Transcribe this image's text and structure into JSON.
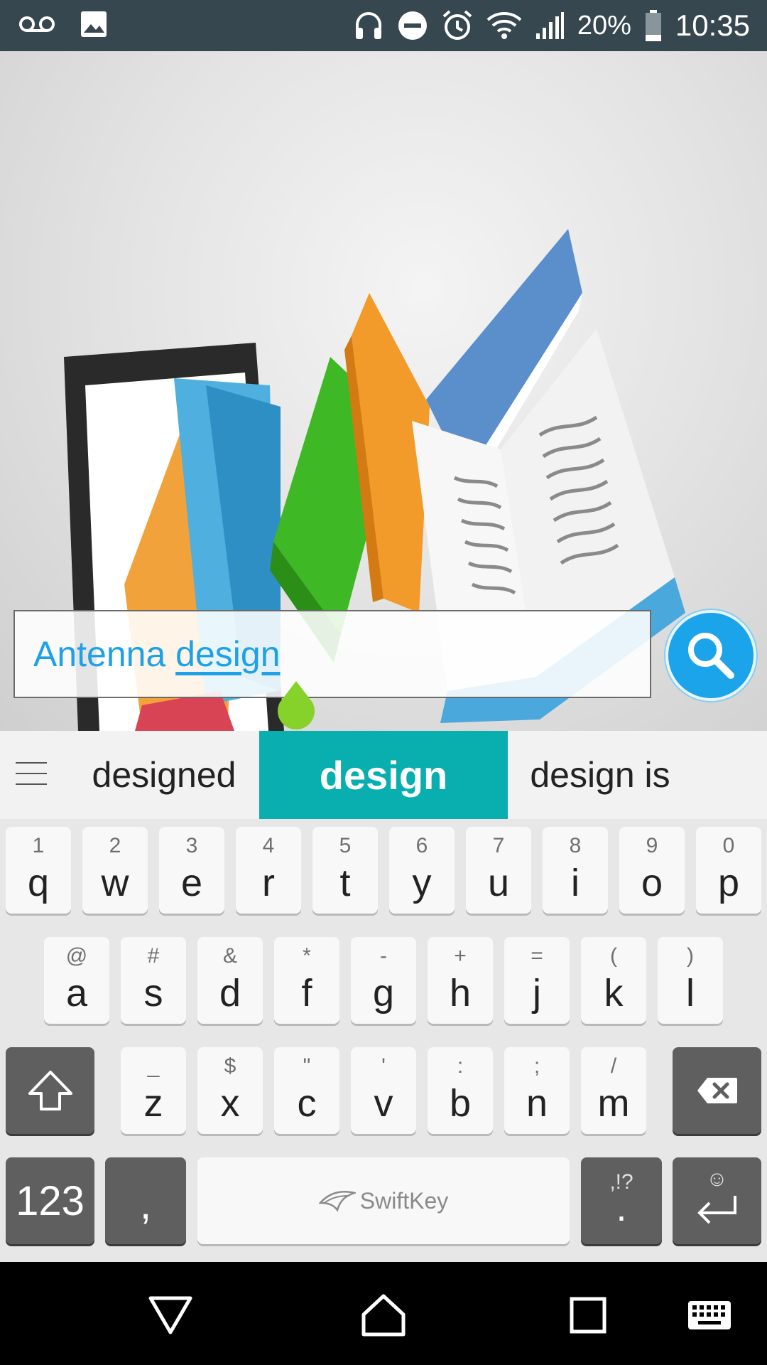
{
  "status_bar": {
    "battery_percent": "20%",
    "time": "10:35",
    "icons": [
      "voicemail-icon",
      "image-icon",
      "headset-icon",
      "dnd-icon",
      "alarm-icon",
      "wifi-icon",
      "signal-icon",
      "battery-icon"
    ]
  },
  "search": {
    "typed_text": "Antenna ",
    "composing_text": "design",
    "text_color": "#1ea1e6",
    "button_color": "#1ca4ea"
  },
  "keyboard": {
    "suggestions": {
      "left": "designed",
      "center": "design",
      "right": "design is"
    },
    "accent_color": "#09afae",
    "row1": [
      {
        "hint": "1",
        "key": "q"
      },
      {
        "hint": "2",
        "key": "w"
      },
      {
        "hint": "3",
        "key": "e"
      },
      {
        "hint": "4",
        "key": "r"
      },
      {
        "hint": "5",
        "key": "t"
      },
      {
        "hint": "6",
        "key": "y"
      },
      {
        "hint": "7",
        "key": "u"
      },
      {
        "hint": "8",
        "key": "i"
      },
      {
        "hint": "9",
        "key": "o"
      },
      {
        "hint": "0",
        "key": "p"
      }
    ],
    "row2": [
      {
        "hint": "@",
        "key": "a"
      },
      {
        "hint": "#",
        "key": "s"
      },
      {
        "hint": "&",
        "key": "d"
      },
      {
        "hint": "*",
        "key": "f"
      },
      {
        "hint": "-",
        "key": "g"
      },
      {
        "hint": "+",
        "key": "h"
      },
      {
        "hint": "=",
        "key": "j"
      },
      {
        "hint": "(",
        "key": "k"
      },
      {
        "hint": ")",
        "key": "l"
      }
    ],
    "row3": [
      {
        "hint": "_",
        "key": "z"
      },
      {
        "hint": "$",
        "key": "x"
      },
      {
        "hint": "\"",
        "key": "c"
      },
      {
        "hint": "'",
        "key": "v"
      },
      {
        "hint": ":",
        "key": "b"
      },
      {
        "hint": ";",
        "key": "n"
      },
      {
        "hint": "/",
        "key": "m"
      }
    ],
    "numbers_label": "123",
    "comma_label": ",",
    "space_brand": "SwiftKey",
    "punct_hint": ",!?",
    "punct_main": ".",
    "enter_hint": "☺"
  },
  "nav_bar": {
    "items": [
      "back-icon",
      "home-icon",
      "recents-icon",
      "keyboard-switch-icon"
    ]
  }
}
